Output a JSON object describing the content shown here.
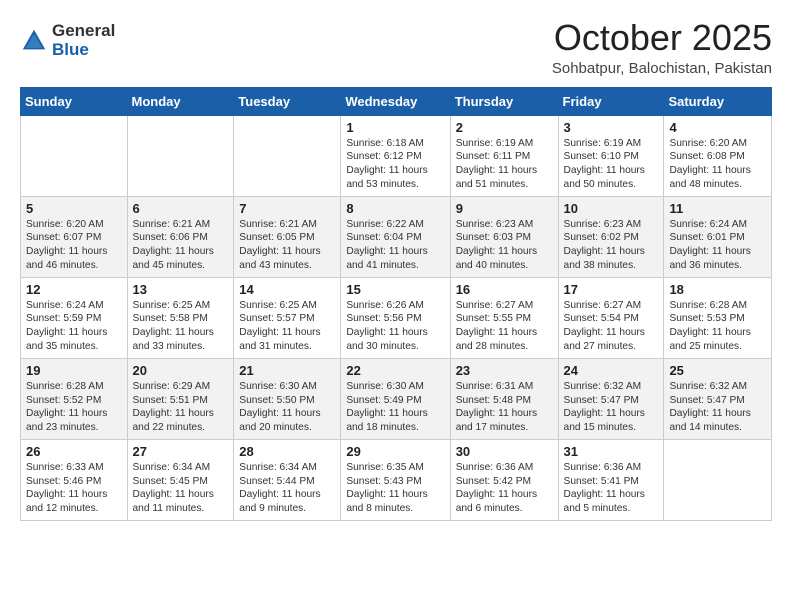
{
  "header": {
    "logo": {
      "general": "General",
      "blue": "Blue"
    },
    "title": "October 2025",
    "location": "Sohbatpur, Balochistan, Pakistan"
  },
  "days_of_week": [
    "Sunday",
    "Monday",
    "Tuesday",
    "Wednesday",
    "Thursday",
    "Friday",
    "Saturday"
  ],
  "weeks": [
    [
      {
        "day": "",
        "info": ""
      },
      {
        "day": "",
        "info": ""
      },
      {
        "day": "",
        "info": ""
      },
      {
        "day": "1",
        "info": "Sunrise: 6:18 AM\nSunset: 6:12 PM\nDaylight: 11 hours\nand 53 minutes."
      },
      {
        "day": "2",
        "info": "Sunrise: 6:19 AM\nSunset: 6:11 PM\nDaylight: 11 hours\nand 51 minutes."
      },
      {
        "day": "3",
        "info": "Sunrise: 6:19 AM\nSunset: 6:10 PM\nDaylight: 11 hours\nand 50 minutes."
      },
      {
        "day": "4",
        "info": "Sunrise: 6:20 AM\nSunset: 6:08 PM\nDaylight: 11 hours\nand 48 minutes."
      }
    ],
    [
      {
        "day": "5",
        "info": "Sunrise: 6:20 AM\nSunset: 6:07 PM\nDaylight: 11 hours\nand 46 minutes."
      },
      {
        "day": "6",
        "info": "Sunrise: 6:21 AM\nSunset: 6:06 PM\nDaylight: 11 hours\nand 45 minutes."
      },
      {
        "day": "7",
        "info": "Sunrise: 6:21 AM\nSunset: 6:05 PM\nDaylight: 11 hours\nand 43 minutes."
      },
      {
        "day": "8",
        "info": "Sunrise: 6:22 AM\nSunset: 6:04 PM\nDaylight: 11 hours\nand 41 minutes."
      },
      {
        "day": "9",
        "info": "Sunrise: 6:23 AM\nSunset: 6:03 PM\nDaylight: 11 hours\nand 40 minutes."
      },
      {
        "day": "10",
        "info": "Sunrise: 6:23 AM\nSunset: 6:02 PM\nDaylight: 11 hours\nand 38 minutes."
      },
      {
        "day": "11",
        "info": "Sunrise: 6:24 AM\nSunset: 6:01 PM\nDaylight: 11 hours\nand 36 minutes."
      }
    ],
    [
      {
        "day": "12",
        "info": "Sunrise: 6:24 AM\nSunset: 5:59 PM\nDaylight: 11 hours\nand 35 minutes."
      },
      {
        "day": "13",
        "info": "Sunrise: 6:25 AM\nSunset: 5:58 PM\nDaylight: 11 hours\nand 33 minutes."
      },
      {
        "day": "14",
        "info": "Sunrise: 6:25 AM\nSunset: 5:57 PM\nDaylight: 11 hours\nand 31 minutes."
      },
      {
        "day": "15",
        "info": "Sunrise: 6:26 AM\nSunset: 5:56 PM\nDaylight: 11 hours\nand 30 minutes."
      },
      {
        "day": "16",
        "info": "Sunrise: 6:27 AM\nSunset: 5:55 PM\nDaylight: 11 hours\nand 28 minutes."
      },
      {
        "day": "17",
        "info": "Sunrise: 6:27 AM\nSunset: 5:54 PM\nDaylight: 11 hours\nand 27 minutes."
      },
      {
        "day": "18",
        "info": "Sunrise: 6:28 AM\nSunset: 5:53 PM\nDaylight: 11 hours\nand 25 minutes."
      }
    ],
    [
      {
        "day": "19",
        "info": "Sunrise: 6:28 AM\nSunset: 5:52 PM\nDaylight: 11 hours\nand 23 minutes."
      },
      {
        "day": "20",
        "info": "Sunrise: 6:29 AM\nSunset: 5:51 PM\nDaylight: 11 hours\nand 22 minutes."
      },
      {
        "day": "21",
        "info": "Sunrise: 6:30 AM\nSunset: 5:50 PM\nDaylight: 11 hours\nand 20 minutes."
      },
      {
        "day": "22",
        "info": "Sunrise: 6:30 AM\nSunset: 5:49 PM\nDaylight: 11 hours\nand 18 minutes."
      },
      {
        "day": "23",
        "info": "Sunrise: 6:31 AM\nSunset: 5:48 PM\nDaylight: 11 hours\nand 17 minutes."
      },
      {
        "day": "24",
        "info": "Sunrise: 6:32 AM\nSunset: 5:47 PM\nDaylight: 11 hours\nand 15 minutes."
      },
      {
        "day": "25",
        "info": "Sunrise: 6:32 AM\nSunset: 5:47 PM\nDaylight: 11 hours\nand 14 minutes."
      }
    ],
    [
      {
        "day": "26",
        "info": "Sunrise: 6:33 AM\nSunset: 5:46 PM\nDaylight: 11 hours\nand 12 minutes."
      },
      {
        "day": "27",
        "info": "Sunrise: 6:34 AM\nSunset: 5:45 PM\nDaylight: 11 hours\nand 11 minutes."
      },
      {
        "day": "28",
        "info": "Sunrise: 6:34 AM\nSunset: 5:44 PM\nDaylight: 11 hours\nand 9 minutes."
      },
      {
        "day": "29",
        "info": "Sunrise: 6:35 AM\nSunset: 5:43 PM\nDaylight: 11 hours\nand 8 minutes."
      },
      {
        "day": "30",
        "info": "Sunrise: 6:36 AM\nSunset: 5:42 PM\nDaylight: 11 hours\nand 6 minutes."
      },
      {
        "day": "31",
        "info": "Sunrise: 6:36 AM\nSunset: 5:41 PM\nDaylight: 11 hours\nand 5 minutes."
      },
      {
        "day": "",
        "info": ""
      }
    ]
  ]
}
